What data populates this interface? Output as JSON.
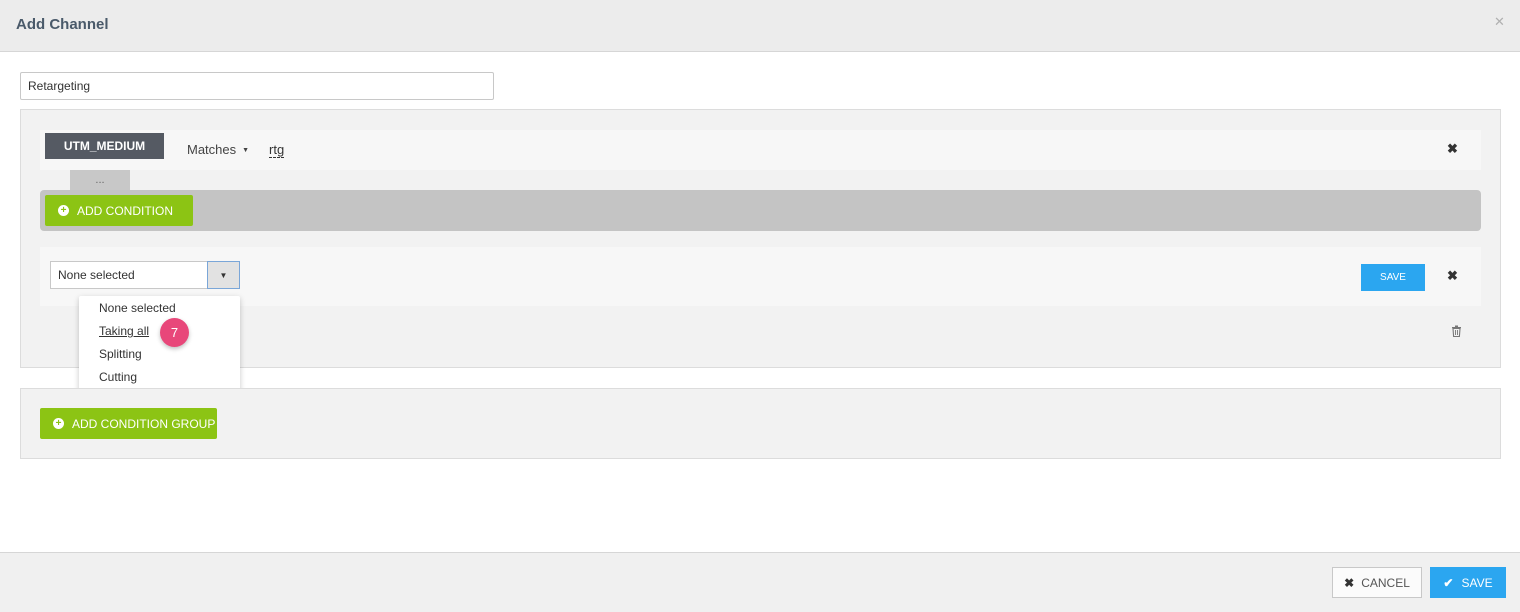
{
  "dialog": {
    "title": "Add Channel"
  },
  "channel": {
    "name_value": "Retargeting"
  },
  "condition_group": {
    "condition": {
      "field": "UTM_MEDIUM",
      "operator": "Matches",
      "value": "rtg"
    },
    "ellipsis": "...",
    "add_condition_label": "ADD CONDITION",
    "split": {
      "selected": "None selected",
      "save_label": "SAVE",
      "options": [
        "None selected",
        "Taking all",
        "Splitting",
        "Cutting"
      ],
      "step_badge": "7"
    }
  },
  "add_condition_group_label": "ADD CONDITION GROUP",
  "footer": {
    "cancel_label": "CANCEL",
    "save_label": "SAVE"
  },
  "colors": {
    "accent_green": "#8cc414",
    "accent_blue": "#2ba6f0",
    "badge_pink": "#e8477a",
    "tag_dark": "#555a63"
  },
  "icons": [
    "close-icon",
    "caret-down-icon",
    "remove-icon",
    "plus-circle-icon",
    "trash-icon",
    "check-icon"
  ]
}
